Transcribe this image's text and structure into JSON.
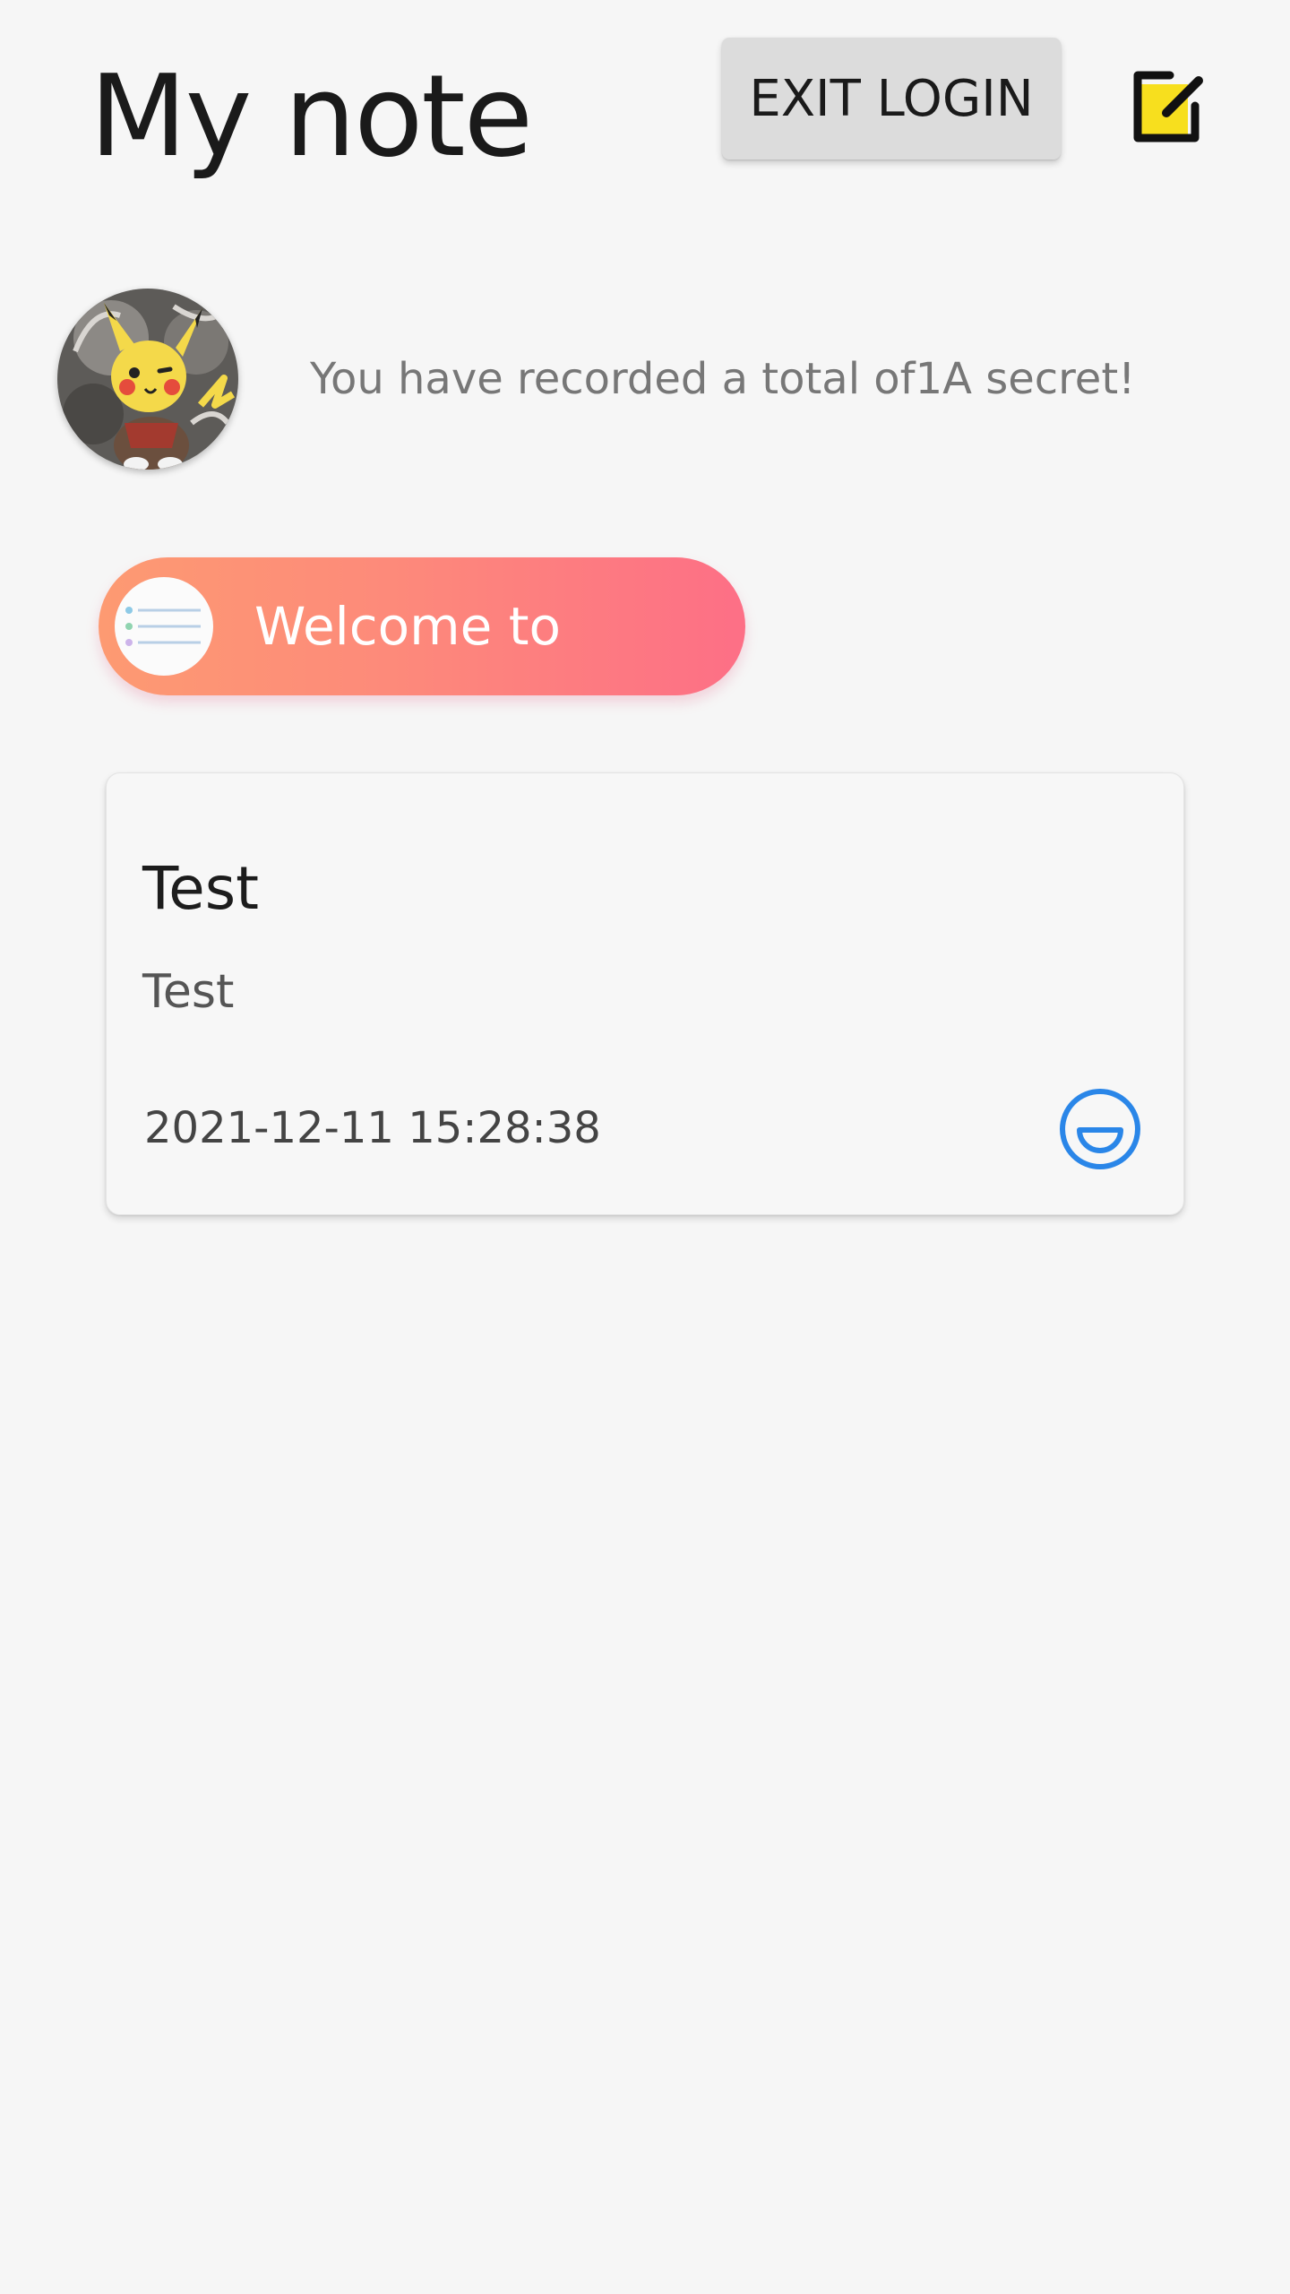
{
  "header": {
    "title": "My note",
    "exit_label": "EXIT LOGIN"
  },
  "profile": {
    "summary": "You have recorded a total of1A secret!"
  },
  "welcome": {
    "label": "Welcome to"
  },
  "notes": [
    {
      "title": "Test",
      "body": "Test",
      "date": "2021-12-11 15:28:38",
      "mood_icon": "smile-icon"
    }
  ],
  "colors": {
    "background": "#f6f6f6",
    "pill_gradient_start": "#fd9a72",
    "pill_gradient_end": "#fd6f86",
    "mood_blue": "#2a86e8",
    "edit_icon_fill": "#f7df1e"
  }
}
